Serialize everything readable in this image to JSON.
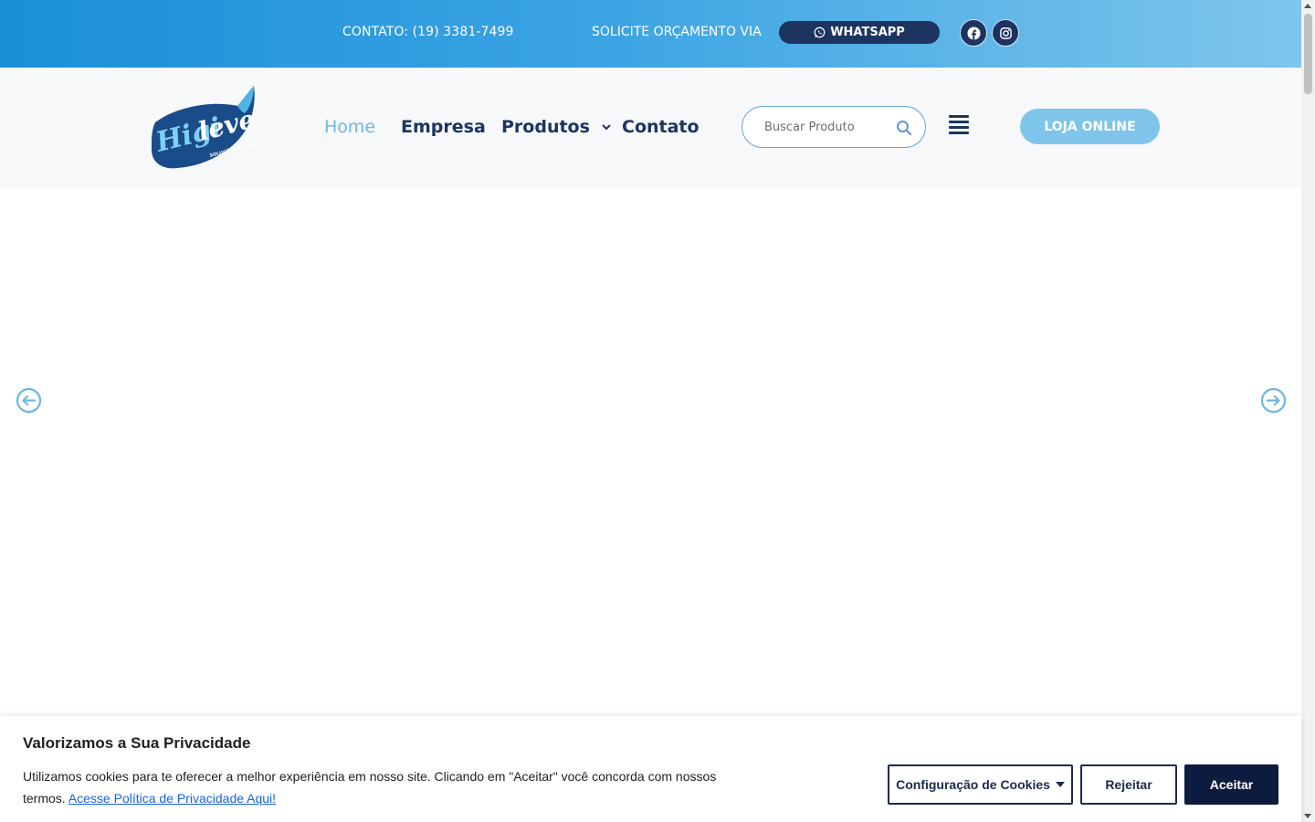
{
  "topbar": {
    "contact": "CONTATO: (19) 3381-7499",
    "quote": "SOLICITE ORÇAMENTO VIA",
    "whatsapp_label": "WHATSAPP",
    "social": [
      {
        "name": "facebook-icon"
      },
      {
        "name": "instagram-icon"
      }
    ]
  },
  "header": {
    "logo_text": "Higileve",
    "logo_tagline": "SOLUÇÕES EM LIMPEZA",
    "nav": [
      {
        "label": "Home",
        "active": true
      },
      {
        "label": "Empresa",
        "active": false
      },
      {
        "label": "Produtos",
        "active": false,
        "has_dropdown": true
      },
      {
        "label": "Contato",
        "active": false
      }
    ],
    "search_placeholder": "Buscar Produto",
    "shop_label": "LOJA ONLINE"
  },
  "slider": {
    "prev_icon": "arrow-left-circle-icon",
    "next_icon": "arrow-right-circle-icon"
  },
  "cookie": {
    "title": "Valorizamos a Sua Privacidade",
    "text": "Utilizamos cookies para te oferecer a melhor experiência em nosso site. Clicando em \"Aceitar\" você concorda com nossos termos.",
    "link": "Acesse Política de Privacidade Aqui!",
    "settings_label": "Configuração de Cookies",
    "reject_label": "Rejeitar",
    "accept_label": "Aceitar"
  },
  "colors": {
    "navy": "#1d3461",
    "accent": "#7ec4eb",
    "active_nav": "#6fb6e3"
  }
}
